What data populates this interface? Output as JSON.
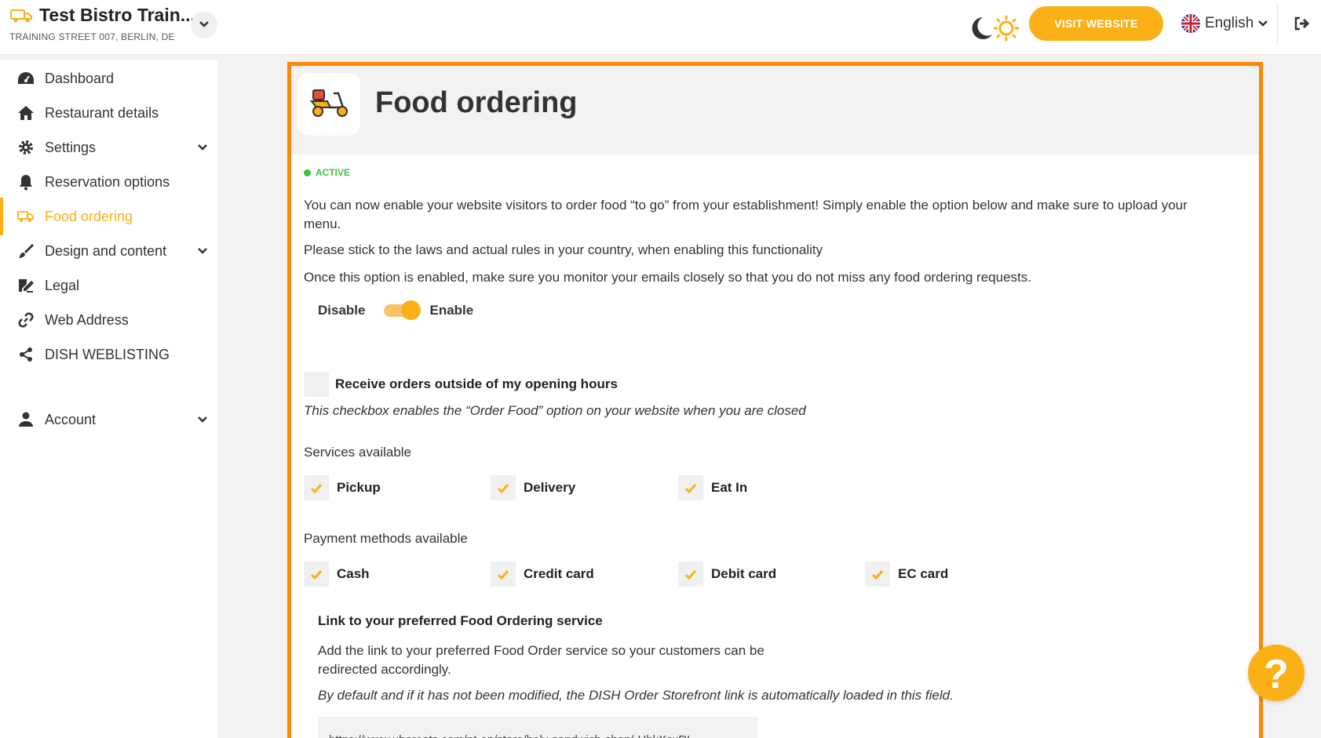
{
  "brand": {
    "title": "Test Bistro Train...",
    "address": "TRAINING STREET 007, BERLIN, DE",
    "icon": "food-truck-icon"
  },
  "topbar": {
    "visit_website": "VISIT WEBSITE",
    "language": "English",
    "accent": "#fbb016"
  },
  "sidebar": {
    "items": [
      {
        "label": "Dashboard",
        "icon": "speedometer-icon"
      },
      {
        "label": "Restaurant details",
        "icon": "home-icon"
      },
      {
        "label": "Settings",
        "icon": "gear-icon"
      },
      {
        "label": "Reservation options",
        "icon": "bell-icon"
      },
      {
        "label": "Food ordering",
        "icon": "food-truck-icon"
      },
      {
        "label": "Design and content",
        "icon": "brush-icon"
      },
      {
        "label": "Legal",
        "icon": "signature-icon"
      },
      {
        "label": "Web Address",
        "icon": "link-icon"
      },
      {
        "label": "DISH WEBLISTING",
        "icon": "share-icon"
      },
      {
        "label": "Account",
        "icon": "user-icon"
      }
    ]
  },
  "main": {
    "title": "Food ordering",
    "status": "ACTIVE",
    "intro": "You can now enable your website visitors to order food “to go” from your establishment! Simply enable the option below and make sure to upload your menu.",
    "laws": "Please stick to the laws and actual rules in your country, when enabling this functionality",
    "monitor": "Once this option is enabled, make sure you monitor your emails closely so that you do not miss any food ordering requests.",
    "toggle": {
      "off_label": "Disable",
      "on_label": "Enable",
      "enabled": true
    },
    "outside_hours": {
      "label": "Receive orders outside of my opening hours",
      "note": "This checkbox enables the “Order Food” option on your website when you are closed",
      "checked": false
    },
    "services": {
      "heading": "Services available",
      "options": [
        "Pickup",
        "Delivery",
        "Eat In"
      ]
    },
    "payments": {
      "heading": "Payment methods available",
      "options": [
        "Cash",
        "Credit card",
        "Debit card",
        "EC card"
      ]
    },
    "link": {
      "heading": "Link to your preferred Food Ordering service",
      "description": "Add the link to your preferred Food Order service so your customers can be redirected accordingly.",
      "note": "By default and if it has not been modified, the DISH Order Storefront link is automatically loaded in this field.",
      "url": "https://www.ubereats.com/pt-en/store/holy-sandwich-shop/-HhkXsxRI"
    }
  },
  "help": {
    "label": "?"
  }
}
